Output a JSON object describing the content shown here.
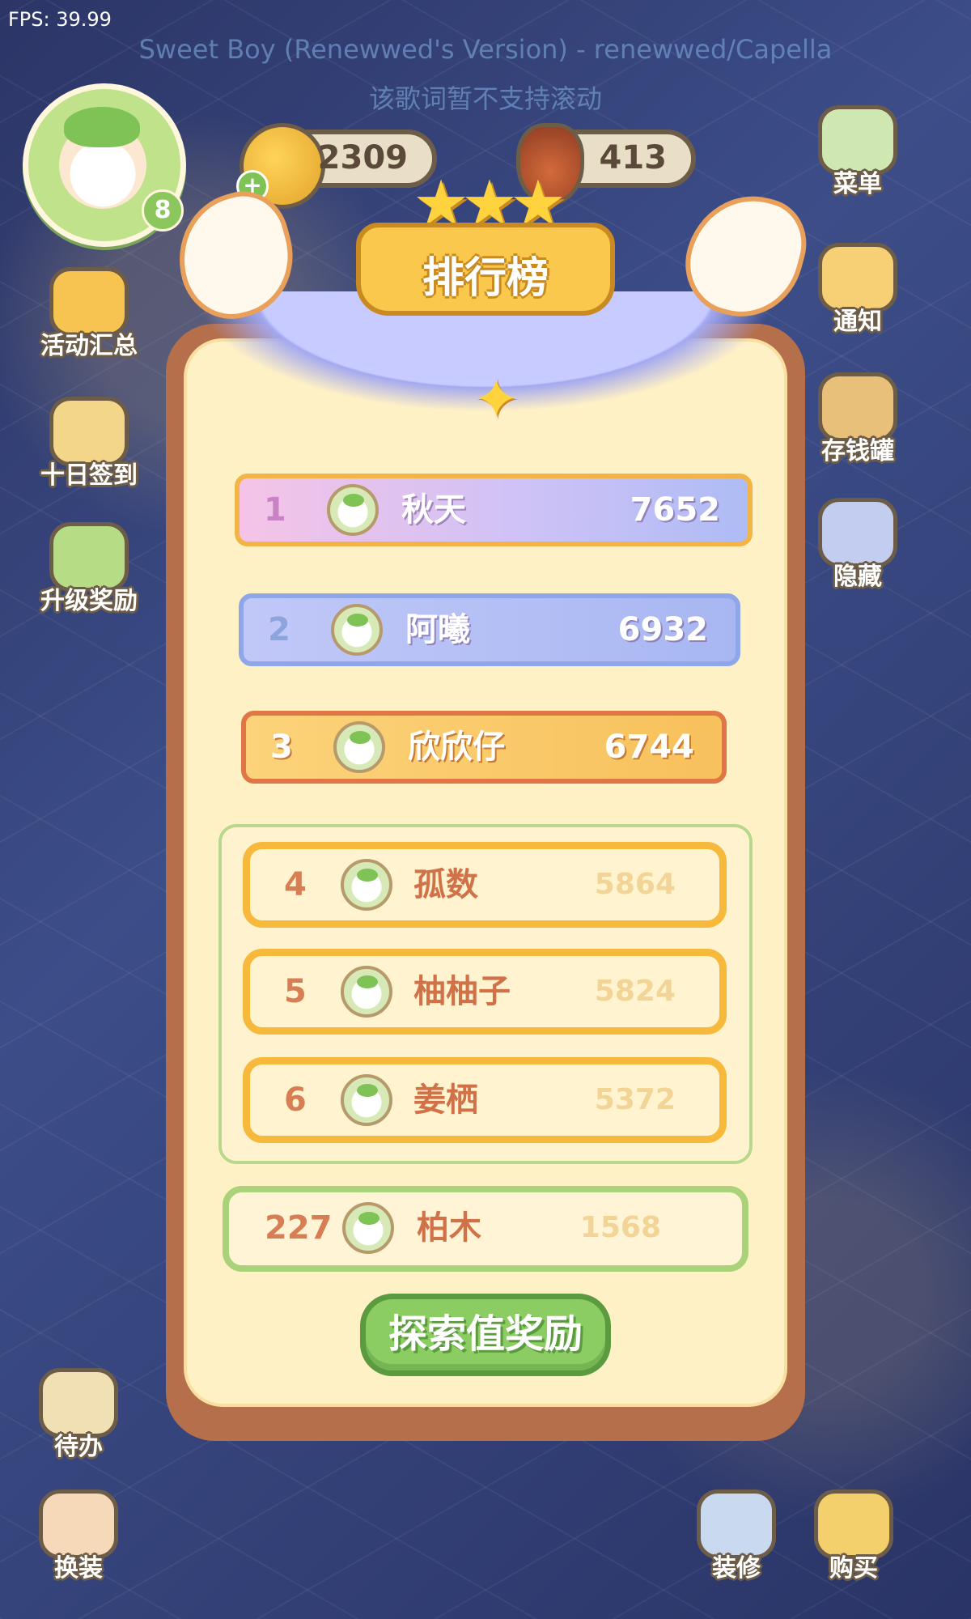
{
  "fps": "FPS: 39.99",
  "song": {
    "title": "Sweet Boy (Renewwed's Version) - renewwed/Capella",
    "lyric_note": "该歌词暂不支持滚动"
  },
  "player": {
    "level": "8"
  },
  "currency": {
    "coins": "2309",
    "meat": "413"
  },
  "left_menu": {
    "activities": "活动汇总",
    "checkin": "十日签到",
    "upgrade": "升级奖励",
    "todo": "待办",
    "dress": "换装"
  },
  "right_menu": {
    "menu": "菜单",
    "notice": "通知",
    "piggybank": "存钱罐",
    "hide": "隐藏",
    "decorate": "装修",
    "buy": "购买"
  },
  "leaderboard": {
    "title": "排行榜",
    "stars": "★★★",
    "top": [
      {
        "rank": "1",
        "name": "秋天",
        "score": "7652"
      },
      {
        "rank": "2",
        "name": "阿曦",
        "score": "6932"
      },
      {
        "rank": "3",
        "name": "欣欣仔",
        "score": "6744"
      }
    ],
    "rows": [
      {
        "rank": "4",
        "name": "孤数",
        "score": "5864"
      },
      {
        "rank": "5",
        "name": "柚柚子",
        "score": "5824"
      },
      {
        "rank": "6",
        "name": "姜栖",
        "score": "5372"
      }
    ],
    "me": {
      "rank": "227",
      "name": "柏木",
      "score": "1568"
    },
    "reward_button": "探索值奖励"
  },
  "colors": {
    "panel": "#b56f4b",
    "cream": "#fff1c6",
    "accent_green": "#8ccd63",
    "gold": "#f9c84c"
  }
}
